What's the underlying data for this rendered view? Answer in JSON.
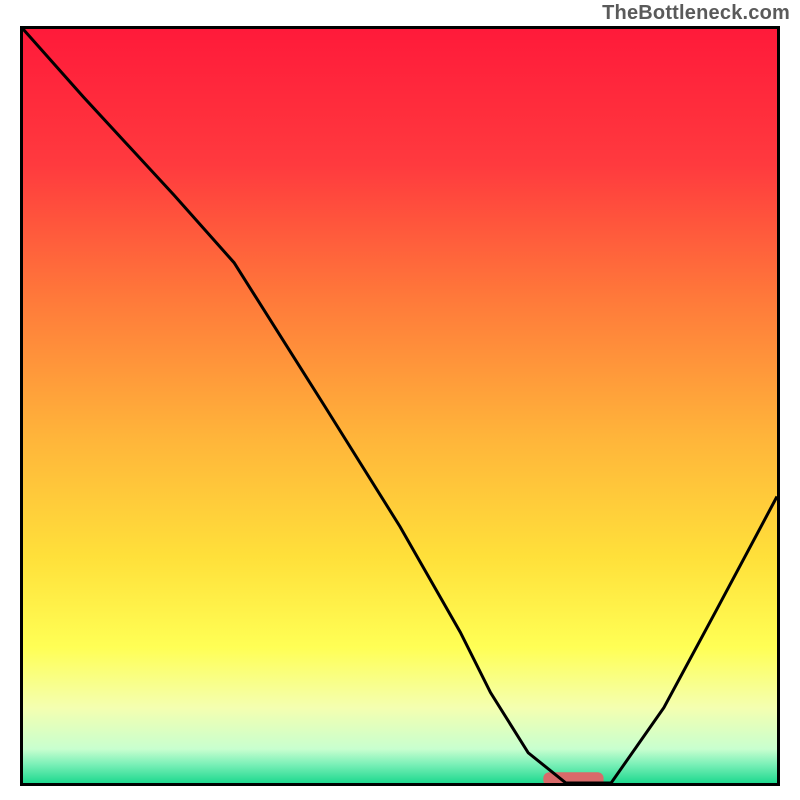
{
  "watermark": "TheBottleneck.com",
  "colors": {
    "border": "#000000",
    "curve": "#000000",
    "marker": "#d96a6a",
    "gradient_stops": [
      {
        "offset": 0.0,
        "color": "#ff1a3a"
      },
      {
        "offset": 0.18,
        "color": "#ff3a3e"
      },
      {
        "offset": 0.36,
        "color": "#ff7a3a"
      },
      {
        "offset": 0.54,
        "color": "#ffb43a"
      },
      {
        "offset": 0.7,
        "color": "#ffe03a"
      },
      {
        "offset": 0.82,
        "color": "#ffff55"
      },
      {
        "offset": 0.9,
        "color": "#f4ffb0"
      },
      {
        "offset": 0.955,
        "color": "#c8ffcf"
      },
      {
        "offset": 0.975,
        "color": "#7cf0b8"
      },
      {
        "offset": 1.0,
        "color": "#1fd98f"
      }
    ]
  },
  "chart_data": {
    "type": "line",
    "title": "",
    "xlabel": "",
    "ylabel": "",
    "xlim": [
      0,
      100
    ],
    "ylim": [
      0,
      100
    ],
    "series": [
      {
        "name": "curve",
        "x": [
          0,
          8,
          20,
          28,
          40,
          50,
          58,
          62,
          67,
          72,
          78,
          85,
          92,
          100
        ],
        "y": [
          100,
          91,
          78,
          69,
          50,
          34,
          20,
          12,
          4,
          0,
          0,
          10,
          23,
          38
        ]
      }
    ],
    "marker": {
      "x_start": 69,
      "x_end": 77,
      "y": 0.5
    }
  }
}
